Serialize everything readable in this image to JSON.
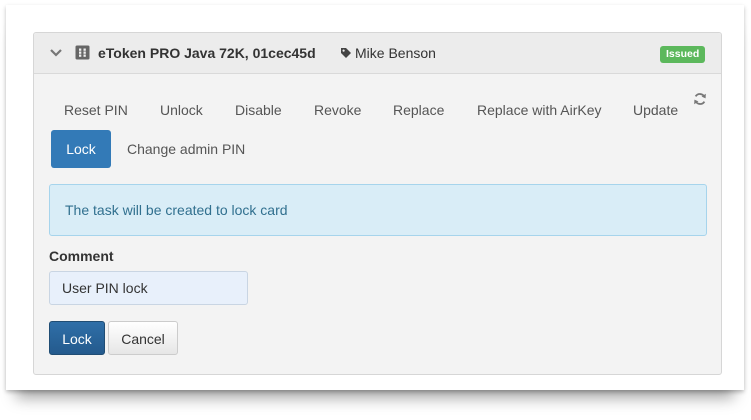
{
  "card": {
    "title": "eToken PRO Java 72K, 01cec45d",
    "owner": "Mike Benson",
    "status": "Issued"
  },
  "tabs": [
    {
      "label": "Reset PIN"
    },
    {
      "label": "Unlock"
    },
    {
      "label": "Disable"
    },
    {
      "label": "Revoke"
    },
    {
      "label": "Replace"
    },
    {
      "label": "Replace with AirKey"
    },
    {
      "label": "Update"
    },
    {
      "label": "Lock",
      "active": true
    },
    {
      "label": "Change admin PIN"
    }
  ],
  "alert": {
    "message": "The task will be created to lock card"
  },
  "form": {
    "comment_label": "Comment",
    "comment_value": "User PIN lock"
  },
  "actions": {
    "submit_label": "Lock",
    "cancel_label": "Cancel"
  },
  "colors": {
    "primary": "#337ab7",
    "status_success": "#5cb85c",
    "info_bg": "#d9edf7",
    "info_text": "#31708f"
  },
  "icons": [
    "chevron-down-icon",
    "card-icon",
    "tag-icon",
    "refresh-icon"
  ]
}
